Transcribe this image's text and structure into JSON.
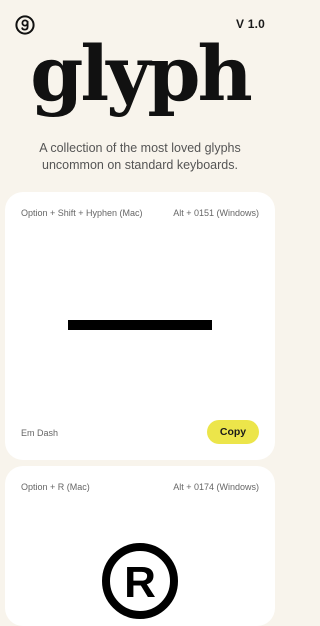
{
  "header": {
    "logo_icon": "g-circle-logo-icon",
    "version": "V 1.0"
  },
  "hero": {
    "wordmark": "glyph",
    "tagline_line1": "A collection of the most loved glyphs",
    "tagline_line2": "uncommon on standard keyboards."
  },
  "cards": [
    {
      "mac_shortcut": "Option + Shift + Hyphen (Mac)",
      "windows_shortcut": "Alt + 0151 (Windows)",
      "glyph_icon": "em-dash-glyph-icon",
      "name": "Em Dash",
      "copy_label": "Copy"
    },
    {
      "mac_shortcut": "Option + R (Mac)",
      "windows_shortcut": "Alt + 0174 (Windows)",
      "glyph_icon": "registered-trademark-glyph-icon",
      "glyph_letter": "R"
    }
  ],
  "colors": {
    "background": "#f8f4ec",
    "card": "#ffffff",
    "accent": "#ece54a",
    "text": "#1a1a1a"
  }
}
